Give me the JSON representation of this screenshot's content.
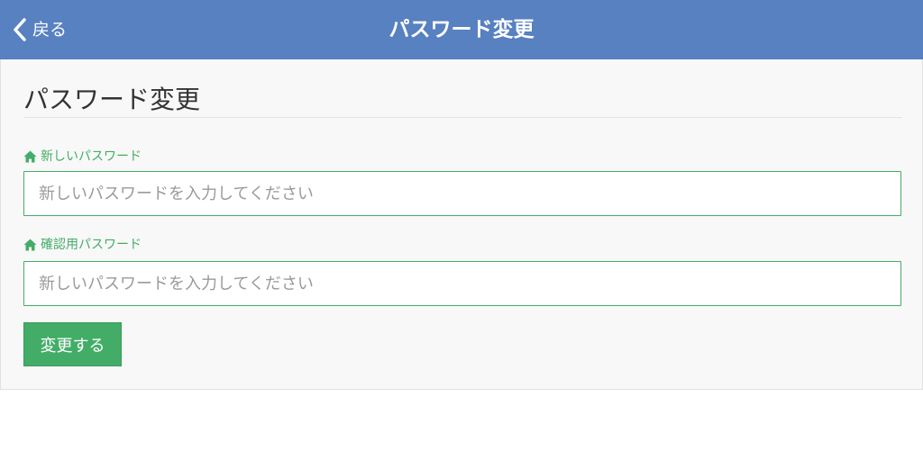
{
  "navbar": {
    "back_label": "戻る",
    "back_icon": "chevron-left-icon",
    "title": "パスワード変更",
    "background_color": "#5781c0"
  },
  "form": {
    "heading": "パスワード変更",
    "new_password": {
      "label": "新しいパスワード",
      "icon": "home-icon",
      "placeholder": "新しいパスワードを入力してください",
      "value": ""
    },
    "confirm_password": {
      "label": "確認用パスワード",
      "icon": "home-icon",
      "placeholder": "新しいパスワードを入力してください",
      "value": ""
    },
    "submit_label": "変更する",
    "accent_color": "#43ad67"
  }
}
